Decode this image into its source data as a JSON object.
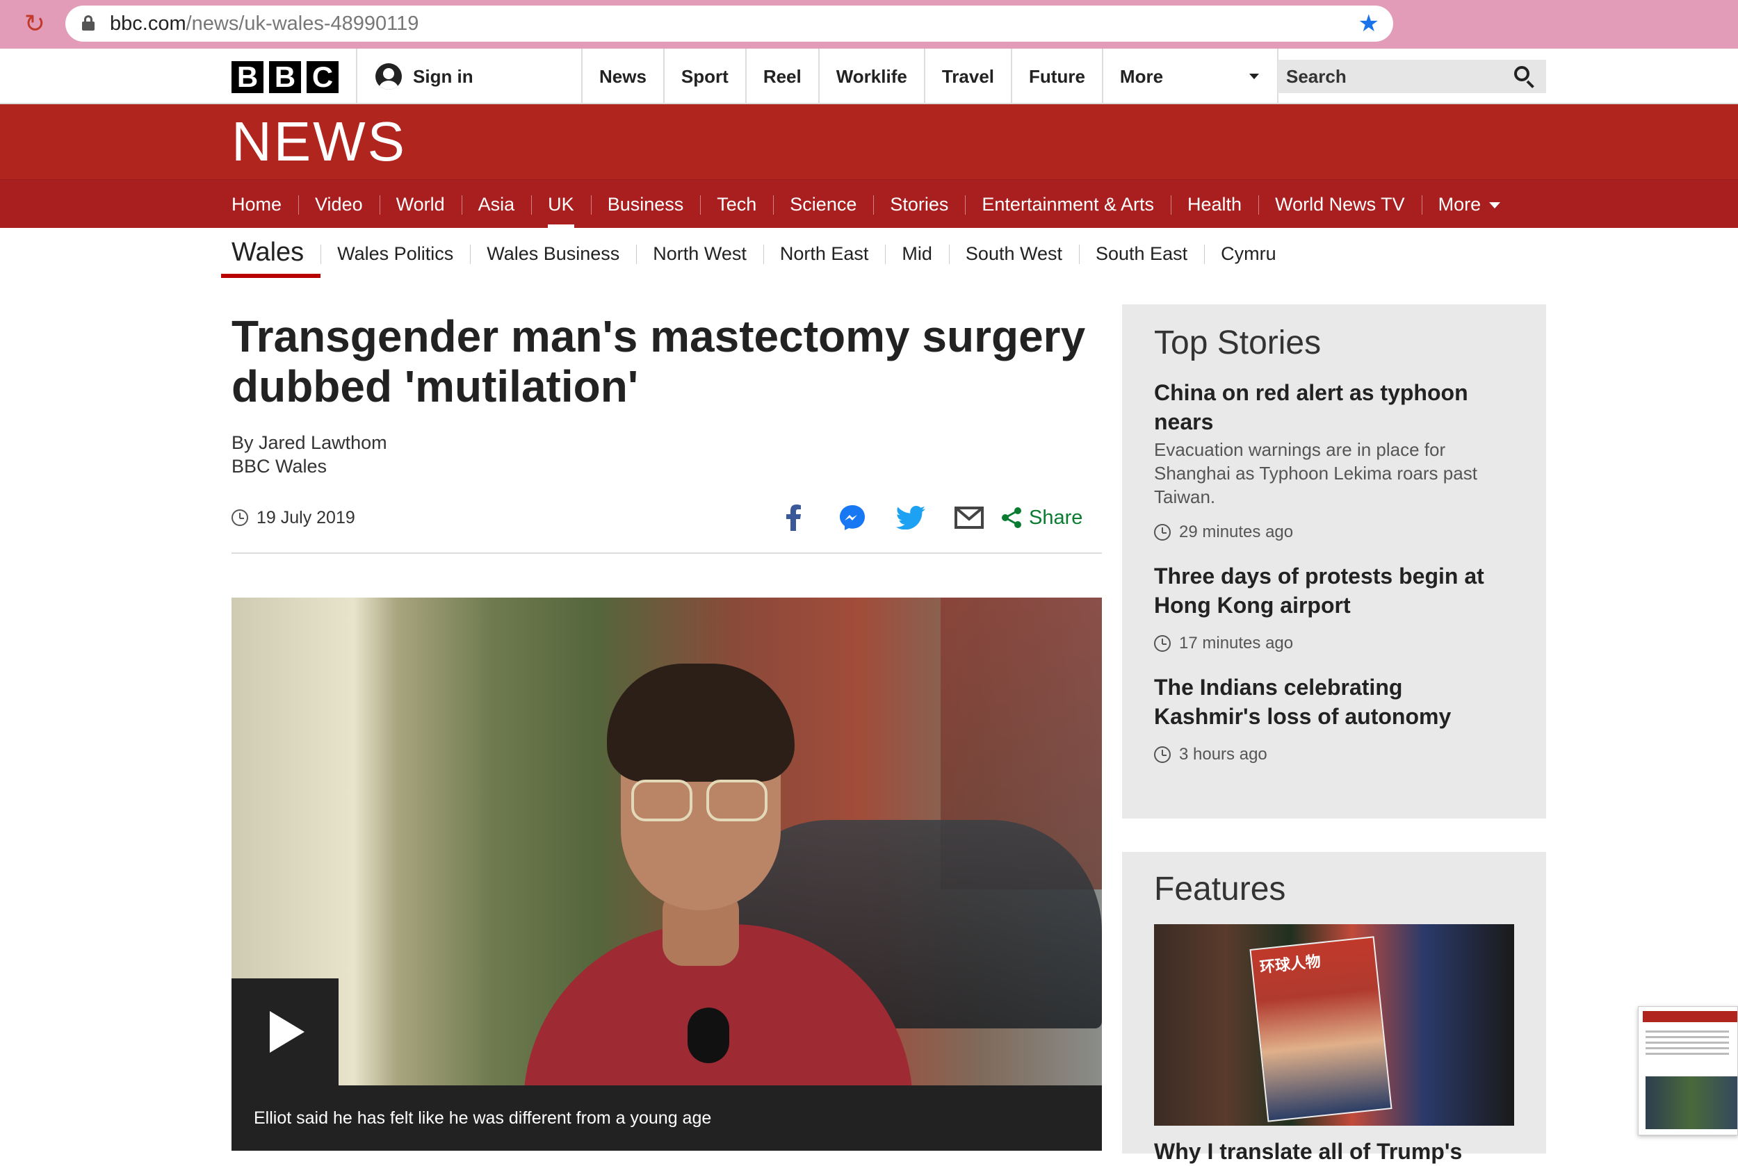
{
  "browser": {
    "url_host": "bbc.com",
    "url_path": "/news/uk-wales-48990119"
  },
  "masthead": {
    "logo_letters": [
      "B",
      "B",
      "C"
    ],
    "sign_in": "Sign in",
    "nav": [
      "News",
      "Sport",
      "Reel",
      "Worklife",
      "Travel",
      "Future"
    ],
    "more": "More",
    "search_placeholder": "Search"
  },
  "news": {
    "wordmark": "NEWS",
    "nav": [
      "Home",
      "Video",
      "World",
      "Asia",
      "UK",
      "Business",
      "Tech",
      "Science",
      "Stories",
      "Entertainment & Arts",
      "Health",
      "World News TV"
    ],
    "active": "UK",
    "more": "More"
  },
  "subnav": {
    "section": "Wales",
    "items": [
      "Wales Politics",
      "Wales Business",
      "North West",
      "North East",
      "Mid",
      "South West",
      "South East",
      "Cymru"
    ]
  },
  "article": {
    "headline": "Transgender man's mastectomy surgery dubbed 'mutilation'",
    "author": "By Jared Lawthom",
    "organisation": "BBC Wales",
    "date": "19 July 2019",
    "share_label": "Share",
    "caption": "Elliot said he has felt like he was different from a young age"
  },
  "top_stories": {
    "title": "Top Stories",
    "stories": [
      {
        "title": "China on red alert as typhoon nears",
        "summary": "Evacuation warnings are in place for Shanghai as Typhoon Lekima roars past Taiwan.",
        "time": "29 minutes ago"
      },
      {
        "title": "Three days of protests begin at Hong Kong airport",
        "summary": "",
        "time": "17 minutes ago"
      },
      {
        "title": "The Indians celebrating Kashmir's loss of autonomy",
        "summary": "",
        "time": "3 hours ago"
      }
    ]
  },
  "features": {
    "title": "Features",
    "image_text": "环球人物",
    "headline": "Why I translate all of Trump's"
  },
  "colors": {
    "bbc_red": "#b0261f",
    "nav_red": "#a91e1e",
    "share_green": "#0a7c32",
    "facebook_blue": "#3b5998",
    "messenger_blue": "#1877f2",
    "twitter_blue": "#1da1f2"
  }
}
